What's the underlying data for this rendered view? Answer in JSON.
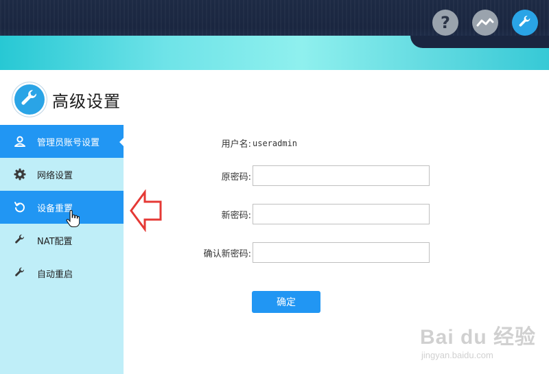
{
  "header": {
    "icons": [
      "help-icon",
      "chart-icon",
      "wrench-icon"
    ]
  },
  "page": {
    "title": "高级设置",
    "title_icon": "wrench-icon"
  },
  "sidebar": {
    "items": [
      {
        "label": "管理员账号设置",
        "icon": "user-icon",
        "active": true
      },
      {
        "label": "网络设置",
        "icon": "gear-icon",
        "active": false
      },
      {
        "label": "设备重置",
        "icon": "reset-icon",
        "active": true
      },
      {
        "label": "NAT配置",
        "icon": "wrench-icon",
        "active": false
      },
      {
        "label": "自动重启",
        "icon": "wrench-icon",
        "active": false
      }
    ]
  },
  "form": {
    "username_label": "用户名:",
    "username_value": "useradmin",
    "old_password_label": "原密码:",
    "new_password_label": "新密码:",
    "confirm_password_label": "确认新密码:",
    "submit_label": "确定"
  },
  "watermark": {
    "brand": "Bai du 经验",
    "url": "jingyan.baidu.com"
  },
  "colors": {
    "accent": "#2196f3",
    "sidebar_bg": "#bfeef8",
    "topbar": "#1d2a44",
    "arrow": "#e53935"
  }
}
